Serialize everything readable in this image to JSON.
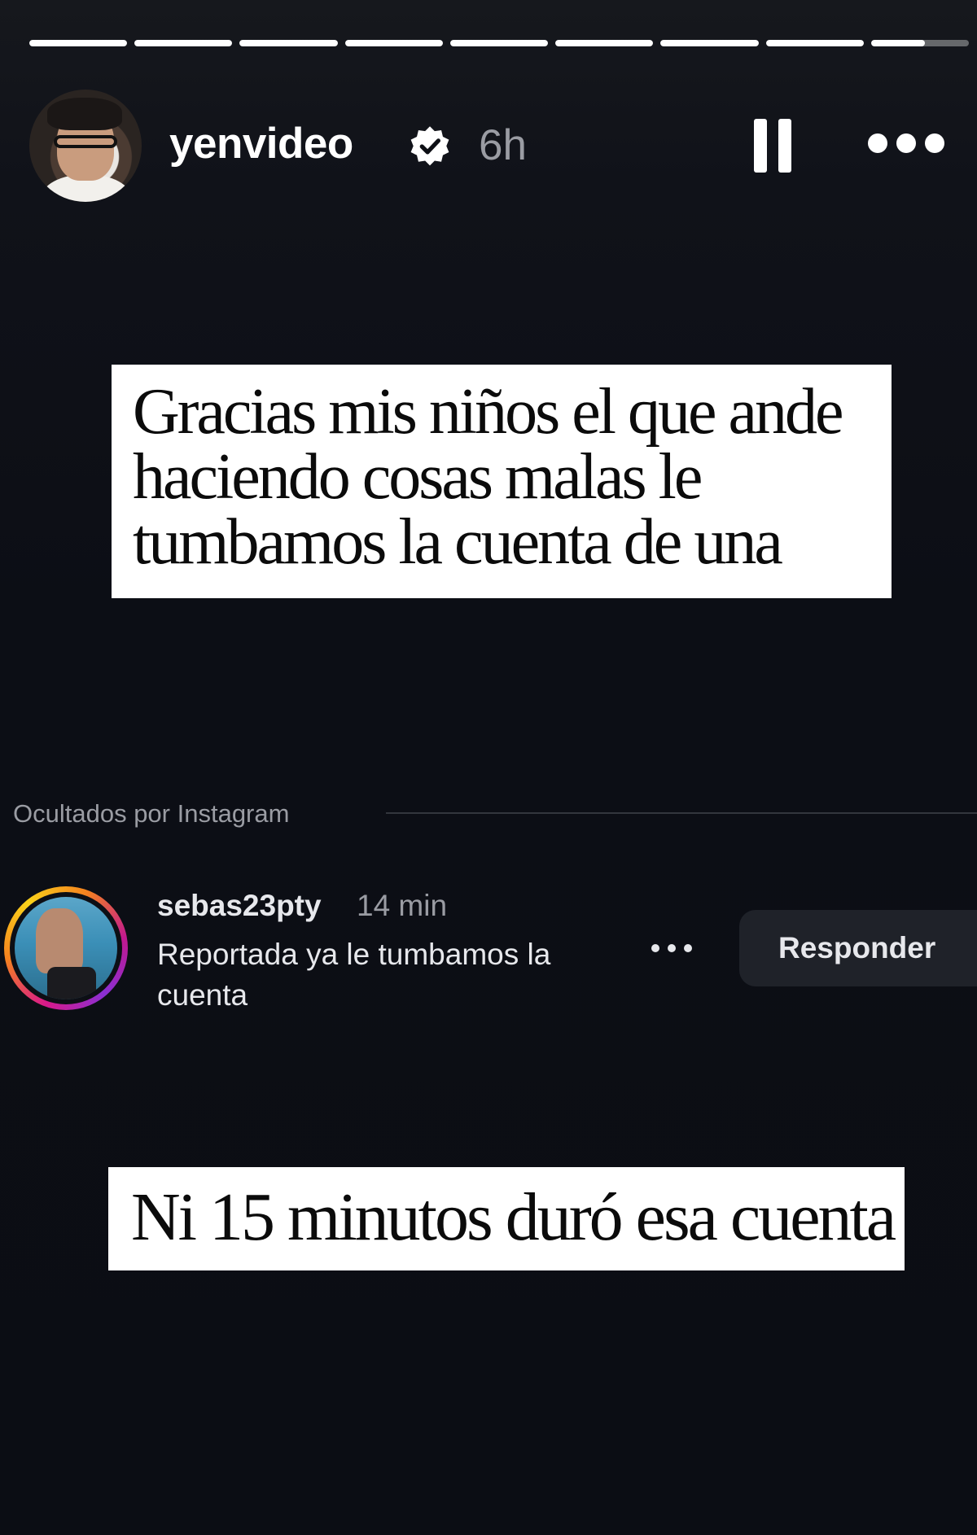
{
  "story": {
    "progress_segments": [
      1,
      1,
      1,
      1,
      1,
      1,
      1,
      1,
      0.55
    ],
    "header": {
      "username": "yenvideo",
      "verified": true,
      "time": "6h",
      "pause_icon": "pause-icon",
      "more_icon": "more-options-icon"
    },
    "sticker_1": {
      "lines": [
        "Gracias mis niños el que ande",
        "haciendo cosas malas le",
        "tumbamos la cuenta de una"
      ]
    },
    "hidden_section": {
      "label": "Ocultados por Instagram"
    },
    "comment": {
      "username": "sebas23pty",
      "time": "14 min",
      "text": "Reportada ya le tumbamos la cuenta",
      "reply_label": "Responder"
    },
    "sticker_2": {
      "text": "Ni 15 minutos duró esa cuenta"
    }
  },
  "colors": {
    "background": "#0d0f15",
    "muted_text": "#9a9ca3",
    "sticker_bg": "#ffffff",
    "reply_button_bg": "#1f2229"
  }
}
